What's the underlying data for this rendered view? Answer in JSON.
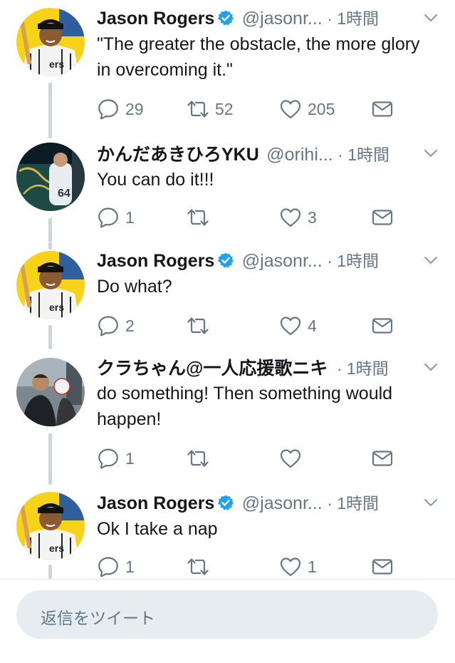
{
  "tweets": [
    {
      "name": "Jason Rogers",
      "verified": true,
      "handle": "@jasonr...",
      "time": "· 1時間",
      "text": "\"The greater the obstacle, the more glory in overcoming it.\"",
      "replies": "29",
      "retweets": "52",
      "likes": "205",
      "avatar": "tigers-cartoon-avatar"
    },
    {
      "name": "かんだあきひろYKU",
      "verified": false,
      "handle": "@orihi...",
      "time": "· 1時間",
      "text": "You can do it!!!",
      "replies": "1",
      "retweets": "",
      "likes": "3",
      "avatar": "baseball-photo-avatar"
    },
    {
      "name": "Jason Rogers",
      "verified": true,
      "handle": "@jasonr...",
      "time": "· 1時間",
      "text": "Do what?",
      "replies": "2",
      "retweets": "",
      "likes": "4",
      "avatar": "tigers-cartoon-avatar"
    },
    {
      "name": "クラちゃん@一人応援歌ニキ",
      "verified": false,
      "handle": "",
      "time": "· 1時間",
      "text": "do something! Then something would happen!",
      "replies": "1",
      "retweets": "",
      "likes": "",
      "avatar": "two-people-photo-avatar"
    },
    {
      "name": "Jason Rogers",
      "verified": true,
      "handle": "@jasonr...",
      "time": "· 1時間",
      "text": "Ok I take a nap",
      "replies": "1",
      "retweets": "",
      "likes": "1",
      "avatar": "tigers-cartoon-avatar"
    }
  ],
  "reply_bar": {
    "placeholder": "返信をツイート"
  },
  "colors": {
    "text": "#14171a",
    "secondary": "#657786",
    "verified": "#1da1f2",
    "thread_line": "#ccd6dd",
    "reply_bar_bg": "#e6ecf0",
    "avatar_yellow": "#f7d21b"
  },
  "icons": [
    "reply-icon",
    "retweet-icon",
    "like-icon",
    "dm-icon",
    "chevron-down-icon",
    "verified-badge-icon"
  ]
}
